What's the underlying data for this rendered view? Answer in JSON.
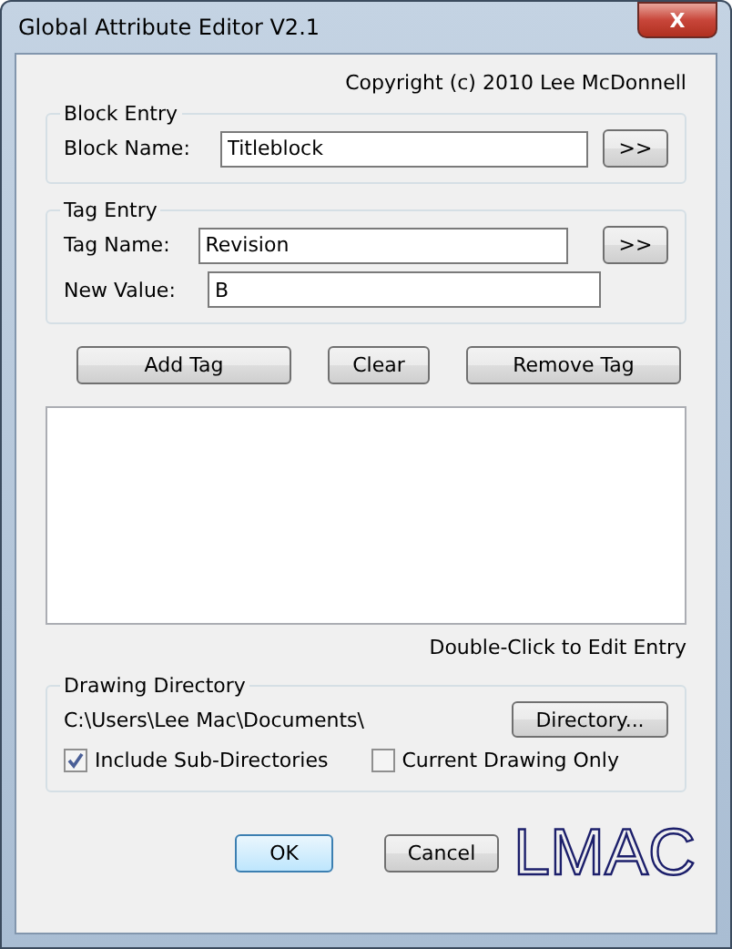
{
  "window": {
    "title": "Global Attribute Editor V2.1",
    "close": "X"
  },
  "copyright": "Copyright (c) 2010 Lee McDonnell",
  "block_entry": {
    "title": "Block Entry",
    "label": "Block Name:",
    "value": "Titleblock",
    "button": ">>"
  },
  "tag_entry": {
    "title": "Tag Entry",
    "tag_label": "Tag Name:",
    "tag_value": "Revision",
    "button": ">>",
    "value_label": "New Value:",
    "value": "B"
  },
  "actions": [
    "Add Tag",
    "Clear",
    "Remove Tag"
  ],
  "hint": "Double-Click to Edit Entry",
  "drawing_directory": {
    "title": "Drawing Directory",
    "path": "C:\\Users\\Lee Mac\\Documents\\",
    "button": "Directory...",
    "options": [
      {
        "label": "Include Sub-Directories",
        "checked": true
      },
      {
        "label": "Current Drawing Only",
        "checked": false
      }
    ]
  },
  "buttons": [
    {
      "label": "OK",
      "selected": true
    },
    {
      "label": "Cancel",
      "selected": false
    }
  ],
  "logo": "LMAC"
}
